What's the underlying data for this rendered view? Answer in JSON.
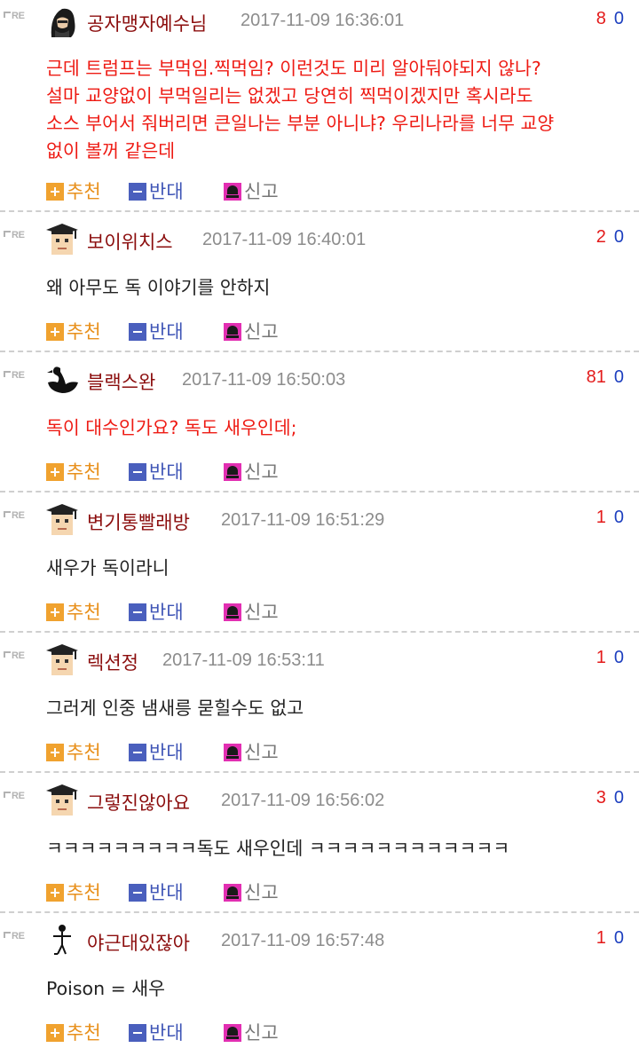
{
  "labels": {
    "re": "RE",
    "recommend": "추천",
    "oppose": "반대",
    "report": "신고"
  },
  "colors": {
    "nick": "#8b0d0d",
    "body_red": "#ee1b14",
    "up": "#e31a1a",
    "down": "#1d3fbf",
    "recommend": "#f0a22f",
    "oppose": "#4a5fbd",
    "report": "#e22fb2"
  },
  "comments": [
    {
      "nick": "공자맹자예수님",
      "avatar": "hooded-figure-avatar",
      "date": "2017-11-09 16:36:01",
      "up": "8",
      "down": "0",
      "body_style": "red",
      "body": "근데 트럼프는 부먹임.찍먹임? 이런것도 미리 알아둬야되지 않나?\n설마 교양없이 부먹일리는 없겠고 당연히 찍먹이겠지만 혹시라도\n소스 부어서 줘버리면 큰일나는 부분 아니냐? 우리나라를 너무 교양\n없이 볼꺼 같은데"
    },
    {
      "nick": "보이위치스",
      "avatar": "graduate-cap-avatar",
      "date": "2017-11-09 16:40:01",
      "up": "2",
      "down": "0",
      "body_style": "black",
      "body": "왜 아무도 독 이야기를 안하지"
    },
    {
      "nick": "블랙스완",
      "avatar": "black-swan-avatar",
      "date": "2017-11-09 16:50:03",
      "up": "81",
      "down": "0",
      "body_style": "red",
      "body": "독이 대수인가요? 독도 새우인데;"
    },
    {
      "nick": "변기통빨래방",
      "avatar": "graduate-cap-avatar",
      "date": "2017-11-09 16:51:29",
      "up": "1",
      "down": "0",
      "body_style": "black",
      "body": "새우가 독이라니"
    },
    {
      "nick": "렉션정",
      "avatar": "graduate-cap-avatar",
      "date": "2017-11-09 16:53:11",
      "up": "1",
      "down": "0",
      "body_style": "black",
      "body": "그러게 인중 냄새릉 묻힐수도 없고"
    },
    {
      "nick": "그렇진않아요",
      "avatar": "graduate-cap-avatar",
      "date": "2017-11-09 16:56:02",
      "up": "3",
      "down": "0",
      "body_style": "black",
      "body": "ㅋㅋㅋㅋㅋㅋㅋㅋㅋ독도 새우인데 ㅋㅋㅋㅋㅋㅋㅋㅋㅋㅋㅋㅋ"
    },
    {
      "nick": "야근대있잖아",
      "avatar": "stick-figure-avatar",
      "date": "2017-11-09 16:57:48",
      "up": "1",
      "down": "0",
      "body_style": "black",
      "body": "Poison = 새우"
    }
  ]
}
